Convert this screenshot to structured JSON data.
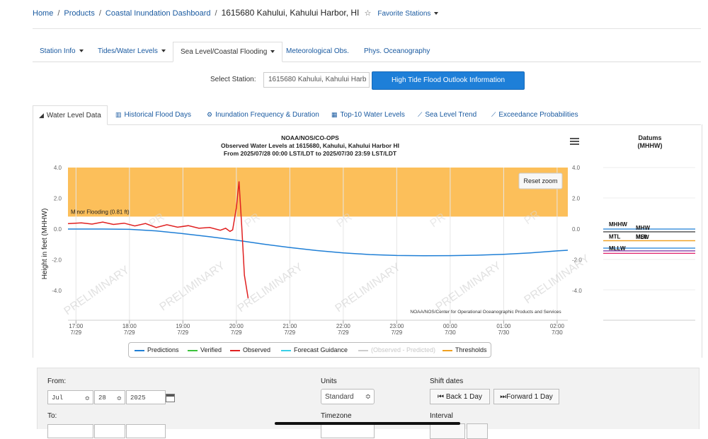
{
  "breadcrumb": {
    "home": "Home",
    "products": "Products",
    "dashboard": "Coastal Inundation Dashboard",
    "current": "1615680 Kahului, Kahului Harbor, HI",
    "favorite_label": "Favorite Stations"
  },
  "tabs": [
    "Station Info",
    "Tides/Water Levels",
    "Sea Level/Coastal Flooding",
    "Meteorological Obs.",
    "Phys. Oceanography"
  ],
  "station_select": {
    "label": "Select Station:",
    "value": "1615680 Kahului, Kahului Harb",
    "button": "High Tide Flood Outlook Information"
  },
  "subtabs": [
    "Water Level Data",
    "Historical Flood Days",
    "Inundation Frequency & Duration",
    "Top-10 Water Levels",
    "Sea Level Trend",
    "Exceedance Probabilities"
  ],
  "chart_data": {
    "type": "line",
    "title": "NOAA/NOS/CO-OPS",
    "subtitle_1": "Observed Water Levels at 1615680, Kahului, Kahului Harbor HI",
    "subtitle_2": "From 2025/07/28 00:00 LST/LDT to 2025/07/30 23:59 LST/LDT",
    "ylabel": "Height in feet (MHHW)",
    "ylim": [
      -5.0,
      4.0
    ],
    "yticks": [
      "4.0",
      "2.0",
      "0.0",
      "-2.0",
      "-4.0"
    ],
    "ytick_values": [
      4,
      2,
      0,
      -2,
      -4
    ],
    "xticks": [
      {
        "time": "17:00",
        "date": "7/29"
      },
      {
        "time": "18:00",
        "date": "7/29"
      },
      {
        "time": "19:00",
        "date": "7/29"
      },
      {
        "time": "20:00",
        "date": "7/29"
      },
      {
        "time": "21:00",
        "date": "7/29"
      },
      {
        "time": "22:00",
        "date": "7/29"
      },
      {
        "time": "23:00",
        "date": "7/29"
      },
      {
        "time": "00:00",
        "date": "7/30"
      },
      {
        "time": "01:00",
        "date": "7/30"
      },
      {
        "time": "02:00",
        "date": "7/30"
      }
    ],
    "x_range_hours": [
      16.85,
      26.2
    ],
    "threshold": {
      "label": "Minor Flooding (0.81 ft)",
      "value": 0.81,
      "top": 4.0,
      "color": "#fcbf5a"
    },
    "series": [
      {
        "name": "Predictions",
        "color": "#1f7fd6",
        "x": [
          16.85,
          17.5,
          18.0,
          18.5,
          19.0,
          19.5,
          20.0,
          20.5,
          21.0,
          21.5,
          22.0,
          22.5,
          23.0,
          23.5,
          24.0,
          24.5,
          25.0,
          25.5,
          26.0,
          26.2
        ],
        "y": [
          0.0,
          0.0,
          -0.02,
          -0.12,
          -0.3,
          -0.5,
          -0.72,
          -0.98,
          -1.2,
          -1.4,
          -1.55,
          -1.66,
          -1.72,
          -1.74,
          -1.73,
          -1.7,
          -1.64,
          -1.55,
          -1.42,
          -1.38
        ]
      },
      {
        "name": "Observed",
        "color": "#e02020",
        "x": [
          16.85,
          17.1,
          17.3,
          17.5,
          17.7,
          17.9,
          18.1,
          18.3,
          18.5,
          18.7,
          18.9,
          19.1,
          19.3,
          19.5,
          19.7,
          19.8,
          19.88,
          19.93,
          20.0,
          20.05,
          20.1,
          20.15,
          20.22
        ],
        "y": [
          0.35,
          0.4,
          0.32,
          0.45,
          0.3,
          0.38,
          0.2,
          0.36,
          0.1,
          0.28,
          0.12,
          0.22,
          0.05,
          0.1,
          -0.08,
          0.05,
          -0.15,
          -0.05,
          1.4,
          3.1,
          0.2,
          -3.0,
          -4.5
        ]
      }
    ],
    "watermark": "PRELIMINARY",
    "credit": "NOAA/NOS/Center for Operational Oceanographic Products and Services",
    "reset_zoom": "Reset zoom",
    "legend": [
      {
        "name": "Predictions",
        "color": "#1f7fd6"
      },
      {
        "name": "Verified",
        "color": "#3cc33c"
      },
      {
        "name": "Observed",
        "color": "#e02020"
      },
      {
        "name": "Forecast Guidance",
        "color": "#3ad0e8"
      },
      {
        "name": "(Observed - Predicted)",
        "color": "#cccccc"
      },
      {
        "name": "Thresholds",
        "color": "#f0a020"
      }
    ]
  },
  "datums": {
    "title_line1": "Datums",
    "title_line2": "(MHHW)",
    "labels": [
      {
        "text": "MHHW",
        "y": 0.0,
        "color": "#1f7fd6"
      },
      {
        "text": "MHW",
        "y": -0.18,
        "color": "#222222"
      },
      {
        "text": "MTL",
        "y": -0.76,
        "color": "#f0a020"
      },
      {
        "text": "MSL",
        "y": -0.76,
        "color": "#f0a020"
      },
      {
        "text": "MLW",
        "y": -1.24,
        "color": "#1f7fd6"
      },
      {
        "text": "MLLW",
        "y": -1.42,
        "color": "#7a2fa0"
      },
      {
        "text": "",
        "y": -1.58,
        "color": "#e0206a"
      }
    ]
  },
  "controls": {
    "from_label": "From:",
    "to_label": "To:",
    "from_month": "Jul",
    "from_day": "28",
    "from_year": "2025",
    "units_label": "Units",
    "units_value": "Standard",
    "timezone_label": "Timezone",
    "shift_label": "Shift dates",
    "back_button": "Back 1 Day",
    "forward_button": "Forward 1 Day",
    "interval_label": "Interval"
  }
}
